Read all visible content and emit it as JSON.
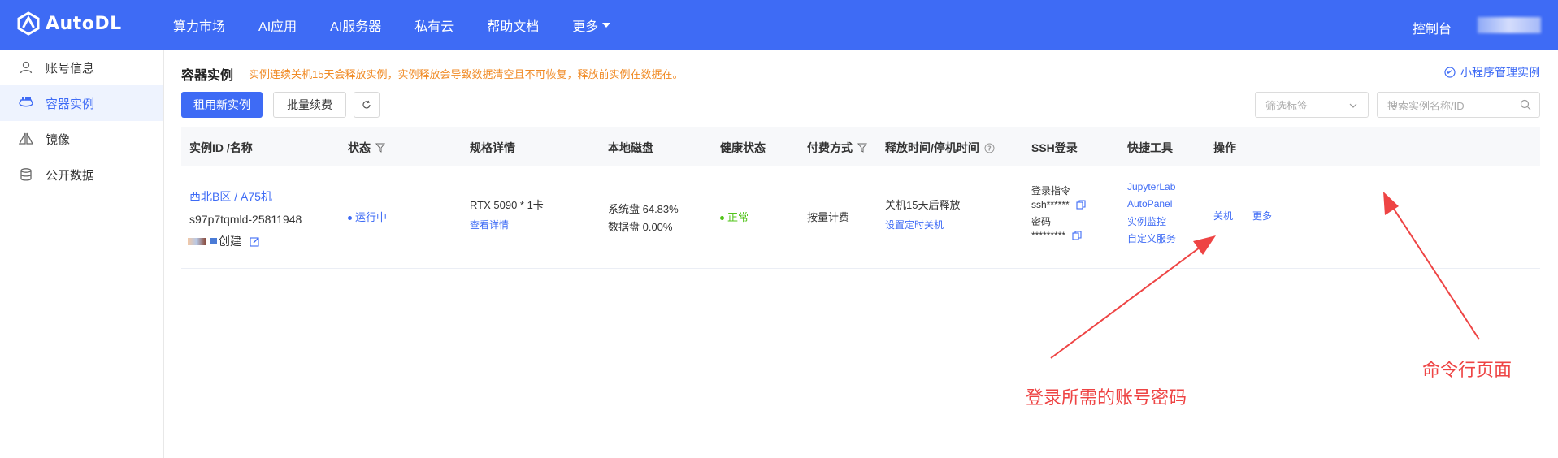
{
  "brand": {
    "name": "AutoDL"
  },
  "nav": {
    "items": [
      "算力市场",
      "AI应用",
      "AI服务器",
      "私有云",
      "帮助文档",
      "更多"
    ],
    "console": "控制台"
  },
  "sidebar": {
    "items": [
      {
        "label": "账号信息",
        "icon": "user-icon"
      },
      {
        "label": "容器实例",
        "icon": "container-icon"
      },
      {
        "label": "镜像",
        "icon": "mirror-icon"
      },
      {
        "label": "公开数据",
        "icon": "database-icon"
      }
    ],
    "active_index": 1
  },
  "page": {
    "title": "容器实例",
    "warning": "实例连续关机15天会释放实例，实例释放会导致数据清空且不可恢复，释放前实例在数据在。",
    "mini_program_link": "小程序管理实例"
  },
  "toolbar": {
    "rent_button": "租用新实例",
    "renew_button": "批量续费",
    "filter_placeholder": "筛选标签",
    "search_placeholder": "搜索实例名称/ID"
  },
  "table": {
    "headers": [
      "实例ID /名称",
      "状态",
      "规格详情",
      "本地磁盘",
      "健康状态",
      "付费方式",
      "释放时间/停机时间",
      "SSH登录",
      "快捷工具",
      "操作"
    ],
    "rows": [
      {
        "region_name": "西北B区 / A75机",
        "instance_id": "s97p7tqmld-25811948",
        "creator_suffix": "创建",
        "status": "运行中",
        "spec": "RTX 5090 * 1卡",
        "spec_link": "查看详情",
        "system_disk": "系统盘 64.83%",
        "data_disk": "数据盘 0.00%",
        "health": "正常",
        "billing": "按量计费",
        "release": "关机15天后释放",
        "release_link": "设置定时关机",
        "ssh_cmd_label": "登录指令",
        "ssh_cmd_value": "ssh******",
        "ssh_pwd_label": "密码",
        "ssh_pwd_value": "*********",
        "tools": [
          "JupyterLab",
          "AutoPanel",
          "实例监控",
          "自定义服务"
        ],
        "actions": [
          "关机",
          "更多"
        ]
      }
    ]
  },
  "annotations": {
    "ssh_note": "登录所需的账号密码",
    "terminal_note": "命令行页面",
    "color": "#ee4444"
  },
  "colors": {
    "brand": "#3e6bf5",
    "warning": "#f08a24",
    "health_ok": "#52c41a"
  }
}
